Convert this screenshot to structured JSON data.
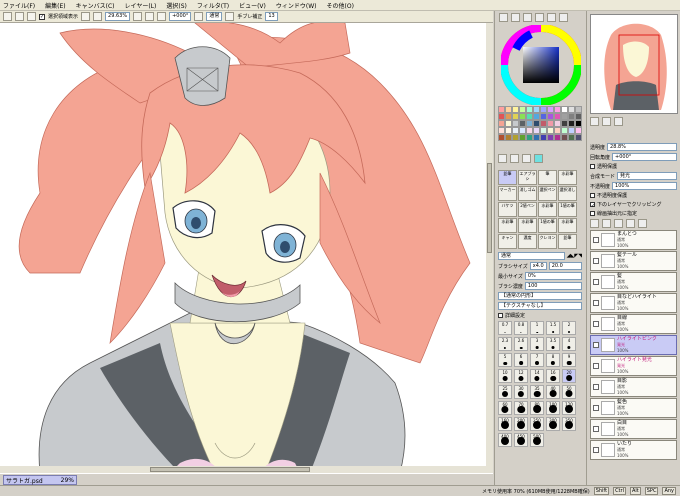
{
  "menu": [
    "ファイル(F)",
    "編集(E)",
    "キャンバス(C)",
    "レイヤー(L)",
    "選択(S)",
    "フィルタ(T)",
    "ビュー(V)",
    "ウィンドウ(W)",
    "その他(O)"
  ],
  "toolbar": {
    "show_selection_label": "選択領域表示",
    "zoom": "29.63%",
    "rotate": "+000°",
    "normal_label": "通常",
    "stabilizer_label": "手ブレ補正",
    "stabilizer_value": "13"
  },
  "document": {
    "name": "サラトガ.psd",
    "zoom": "29%"
  },
  "status": {
    "memory": "メモリ使用率 70% (610MB使用/1228MB確保)",
    "indicators": [
      "Shift",
      "Ctrl",
      "Alt",
      "SPC",
      "Any"
    ]
  },
  "color_sliders": [
    {
      "label": "透明度",
      "value": "28.8%"
    },
    {
      "label": "回転角度",
      "value": "+000°"
    }
  ],
  "layer_options": {
    "protect_label": "透明保護",
    "mode_label": "合成モード",
    "mode_value": "発光",
    "opacity_label": "不透明度",
    "opacity_value": "100%",
    "check1": "不透明度保護",
    "check2": "下のレイヤーでクリッピング",
    "check3": "線画抽出元に指定"
  },
  "tools": {
    "labels": [
      [
        "鉛筆",
        "エアブラシ",
        "筆",
        "水彩筆"
      ],
      [
        "マーカー",
        "消しゴム",
        "選択ペン",
        "選択消し"
      ],
      [
        "バケツ",
        "2値ペン",
        "水彩筆",
        "1値の筆"
      ],
      [
        "水彩筆",
        "水彩筆",
        "1値の筆",
        "水彩筆"
      ],
      [
        "キャン",
        "濃度",
        "クレヨン",
        "鉛筆"
      ]
    ],
    "mode_value": "通常",
    "brush_size_label": "ブラシサイズ",
    "brush_size_mult": "x4.0",
    "brush_size_value": "20.0",
    "min_size_label": "最小サイズ",
    "min_size_value": "0%",
    "density_label": "ブラシ濃度",
    "density_value": "100",
    "texture1": "【通常の円形】",
    "texture2": "【テクスチャなし】",
    "detail_label": "詳細設定",
    "sizes": [
      [
        "0.7",
        "0.8",
        "1",
        "1.5",
        "2"
      ],
      [
        "2.3",
        "2.6",
        "3",
        "3.5",
        "4"
      ],
      [
        "5",
        "6",
        "7",
        "8",
        "9"
      ],
      [
        "10",
        "12",
        "14",
        "16",
        "20"
      ],
      [
        "25",
        "30",
        "35",
        "40",
        "50"
      ],
      [
        "60",
        "70",
        "80",
        "100",
        "120"
      ],
      [
        "160",
        "200",
        "250",
        "300",
        "350"
      ],
      [
        "400",
        "450",
        "500"
      ]
    ]
  },
  "layers": [
    {
      "name": "まんとつ",
      "mode": "通常",
      "pct": "100%",
      "sel": false
    },
    {
      "name": "髪テール",
      "mode": "通常",
      "pct": "100%",
      "sel": false
    },
    {
      "name": "髪",
      "mode": "通常",
      "pct": "100%",
      "sel": false
    },
    {
      "name": "目などハイライト",
      "mode": "通常",
      "pct": "100%",
      "sel": false
    },
    {
      "name": "目線",
      "mode": "通常",
      "pct": "100%",
      "sel": false
    },
    {
      "name": "ハイライトピンク",
      "mode": "発光",
      "pct": "100%",
      "sel": true
    },
    {
      "name": "ハイライト発光",
      "mode": "発光",
      "pct": "100%",
      "sel": false
    },
    {
      "name": "目影",
      "mode": "通常",
      "pct": "100%",
      "sel": false
    },
    {
      "name": "髪色",
      "mode": "通常",
      "pct": "100%",
      "sel": false
    },
    {
      "name": "白目",
      "mode": "通常",
      "pct": "100%",
      "sel": false
    },
    {
      "name": "いたり",
      "mode": "通常",
      "pct": "100%",
      "sel": false
    }
  ]
}
